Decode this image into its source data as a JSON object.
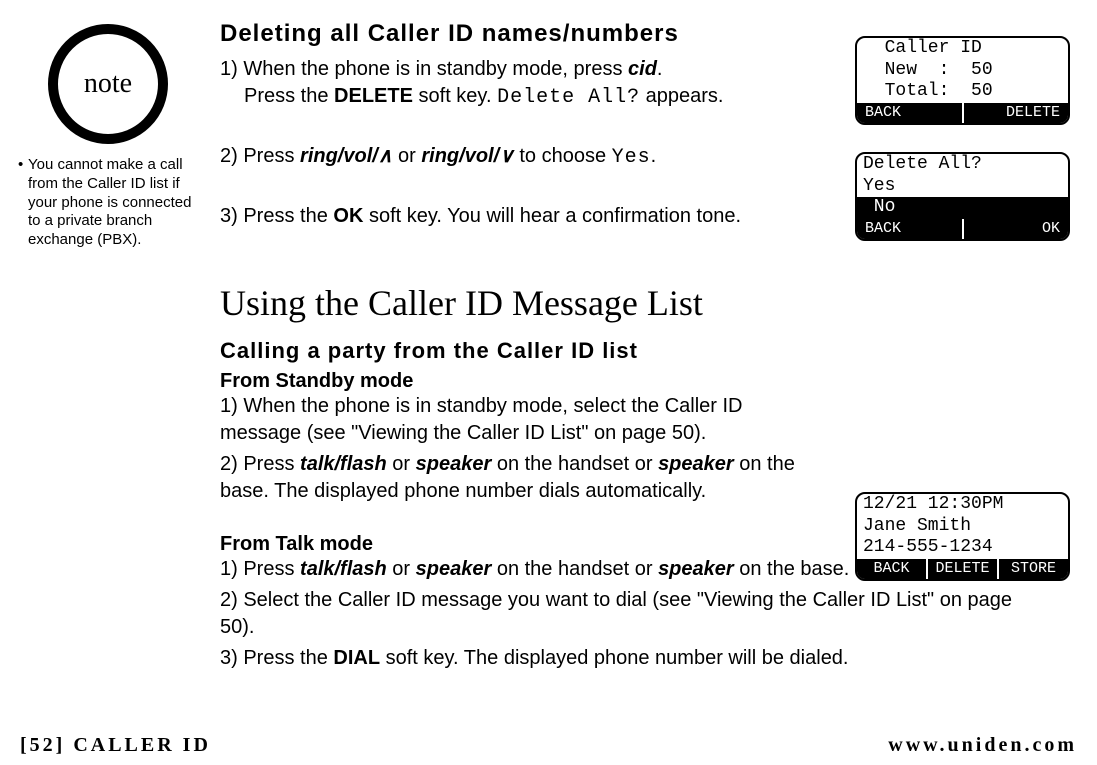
{
  "note": {
    "label": "note",
    "text": "You cannot make a call from the Caller ID list if your phone is connected to a private branch exchange (PBX)."
  },
  "section1": {
    "title": "Deleting all Caller ID names/numbers",
    "step1_a": "1) When the phone is in standby mode, press ",
    "step1_b": "cid",
    "step1_c": ".",
    "step1_d": "Press the ",
    "step1_e": "DELETE",
    "step1_f": " soft key. ",
    "step1_g": "Delete All?",
    "step1_h": " appears.",
    "step2_a": "2) Press ",
    "step2_b": "ring/vol/",
    "step2_c": " or ",
    "step2_d": "ring/vol/",
    "step2_e": " to choose ",
    "step2_f": "Yes",
    "step2_g": ".",
    "step3_a": "3) Press the ",
    "step3_b": "OK",
    "step3_c": " soft key. You will hear a confirmation tone."
  },
  "section2": {
    "title": "Using the Caller ID Message List",
    "sub1": "Calling a party from the Caller ID list",
    "mode1": "From Standby mode",
    "s1_1": "1) When the phone is in standby mode, select the Caller ID message (see \"Viewing the Caller ID List\" on page 50).",
    "s1_2a": "2) Press ",
    "s1_2b": "talk/flash",
    "s1_2c": " or ",
    "s1_2d": "speaker",
    "s1_2e": " on the handset or ",
    "s1_2f": "speaker",
    "s1_2g": " on the base. The displayed phone number dials automatically.",
    "mode2": "From Talk mode",
    "s2_1a": "1) Press ",
    "s2_1b": "talk/flash",
    "s2_1c": " or ",
    "s2_1d": "speaker",
    "s2_1e": " on the handset or ",
    "s2_1f": "speaker",
    "s2_1g": " on the base.",
    "s2_2": "2) Select the Caller ID message you want to dial (see \"Viewing the Caller ID List\" on page 50).",
    "s2_3a": "3) Press the ",
    "s2_3b": "DIAL",
    "s2_3c": " soft key. The displayed phone number will be dialed."
  },
  "screens": {
    "s1": {
      "l1": "  Caller ID",
      "l2": "  New  :  50",
      "l3": "  Total:  50",
      "skL": "BACK",
      "skR": "DELETE"
    },
    "s2": {
      "l1": "Delete All?",
      "l2": "Yes",
      "l3": " No",
      "skL": "BACK",
      "skR": "OK"
    },
    "s3": {
      "l1": "12/21 12:30PM",
      "l2": "Jane Smith",
      "l3": "214-555-1234",
      "sk1": "BACK",
      "sk2": "DELETE",
      "sk3": "STORE"
    }
  },
  "footer": {
    "page": "[52]",
    "section": " CALLER ID",
    "url": "www.uniden.com"
  },
  "glyphs": {
    "up": "∧",
    "down": "∨"
  }
}
